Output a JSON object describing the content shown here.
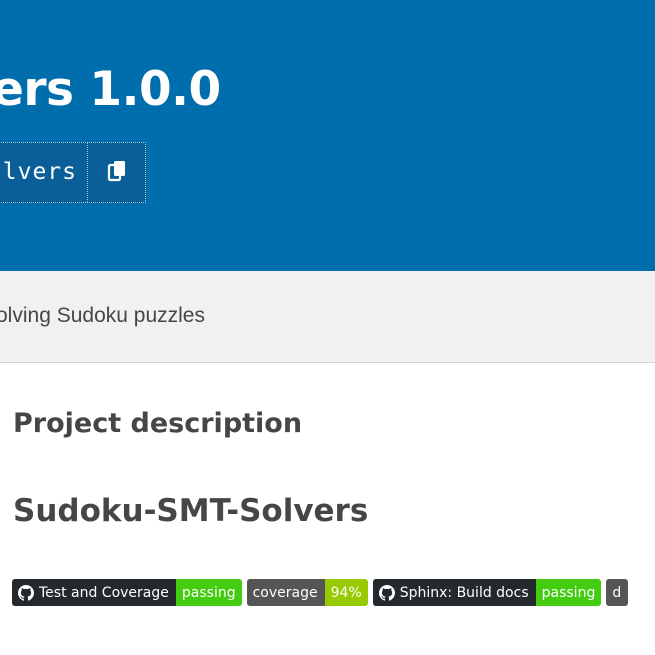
{
  "header": {
    "title": "ers 1.0.0",
    "pip_command": "lvers",
    "copy_icon": "copy-icon",
    "background": "#006DAD"
  },
  "summary": {
    "text": "olving Sudoku puzzles"
  },
  "description": {
    "heading": "Project description",
    "project_title": "Sudoku-SMT-Solvers"
  },
  "badges": [
    {
      "label": "Test and Coverage",
      "value": "passing",
      "icon": "github-icon",
      "color": "#4c1"
    },
    {
      "label": "coverage",
      "value": "94%",
      "icon": "",
      "color": "#97ca00"
    },
    {
      "label": "Sphinx: Build docs",
      "value": "passing",
      "icon": "github-icon",
      "color": "#4c1"
    },
    {
      "label": "d",
      "value": "",
      "icon": "",
      "color": "#555555"
    }
  ]
}
